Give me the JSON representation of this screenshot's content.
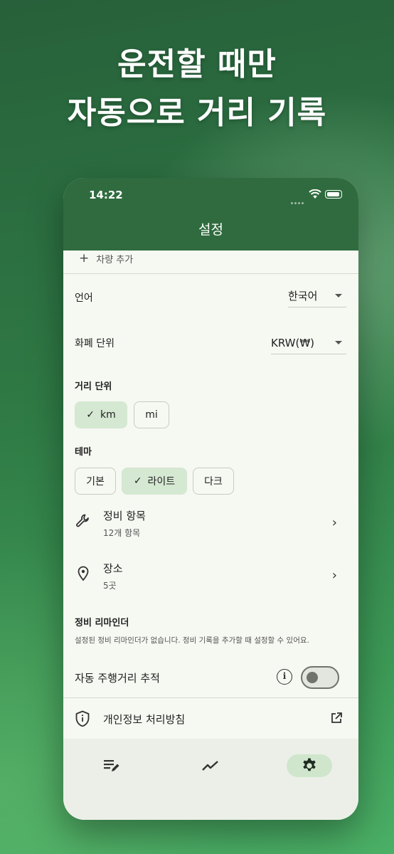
{
  "headline": {
    "line1": "운전할 때만",
    "line2": "자동으로 거리 기록"
  },
  "status_bar": {
    "time": "14:22"
  },
  "app_bar": {
    "title": "설정"
  },
  "settings": {
    "add_vehicle": "차량 추가",
    "language": {
      "label": "언어",
      "value": "한국어"
    },
    "currency": {
      "label": "화폐 단위",
      "value": "KRW(₩)"
    },
    "distance_unit": {
      "label": "거리 단위",
      "options": [
        "km",
        "mi"
      ],
      "selected": "km"
    },
    "theme": {
      "label": "테마",
      "options": [
        "기본",
        "라이트",
        "다크"
      ],
      "selected": "라이트"
    },
    "maintenance_items": {
      "title": "정비 항목",
      "subtitle": "12개 항목"
    },
    "places": {
      "title": "장소",
      "subtitle": "5곳"
    },
    "reminder": {
      "title": "정비 리마인더",
      "description": "설정된 정비 리마인더가 없습니다. 정비 기록을 추가할 때 설정할 수 있어요."
    },
    "auto_tracking": {
      "label": "자동 주행거리 추적",
      "enabled": false
    },
    "privacy": {
      "label": "개인정보 처리방침"
    }
  },
  "bottom_nav": {
    "items": [
      "records-icon",
      "stats-icon",
      "settings-icon"
    ],
    "active": "settings-icon"
  },
  "colors": {
    "primary": "#2f6b3e",
    "selected_chip": "#d5e8d2",
    "background": "#f6f8f2"
  }
}
